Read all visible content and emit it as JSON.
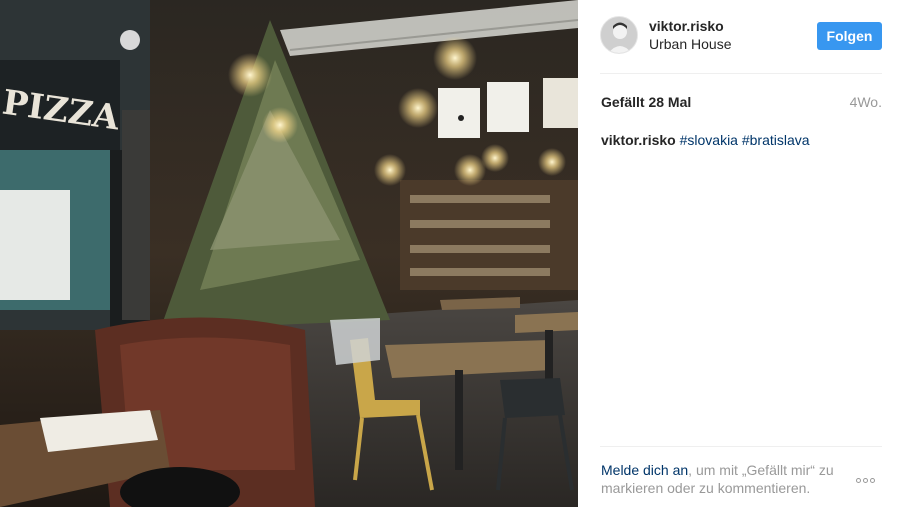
{
  "post": {
    "username": "viktor.risko",
    "location": "Urban House",
    "follow_label": "Folgen",
    "likes": "Gefällt 28 Mal",
    "time_ago": "4Wo.",
    "caption_user": "viktor.risko",
    "hashtags": [
      "#slovakia",
      "#bratislava"
    ],
    "login_link": "Melde dich an",
    "login_prompt": ", um mit „Gefällt mir“ zu markieren oder zu kommentieren.",
    "photo_sign_text": "PIZZA"
  },
  "colors": {
    "follow_button": "#3897f0",
    "link": "#003569",
    "muted": "#999999"
  },
  "icons": {
    "more": "more-options-icon"
  }
}
